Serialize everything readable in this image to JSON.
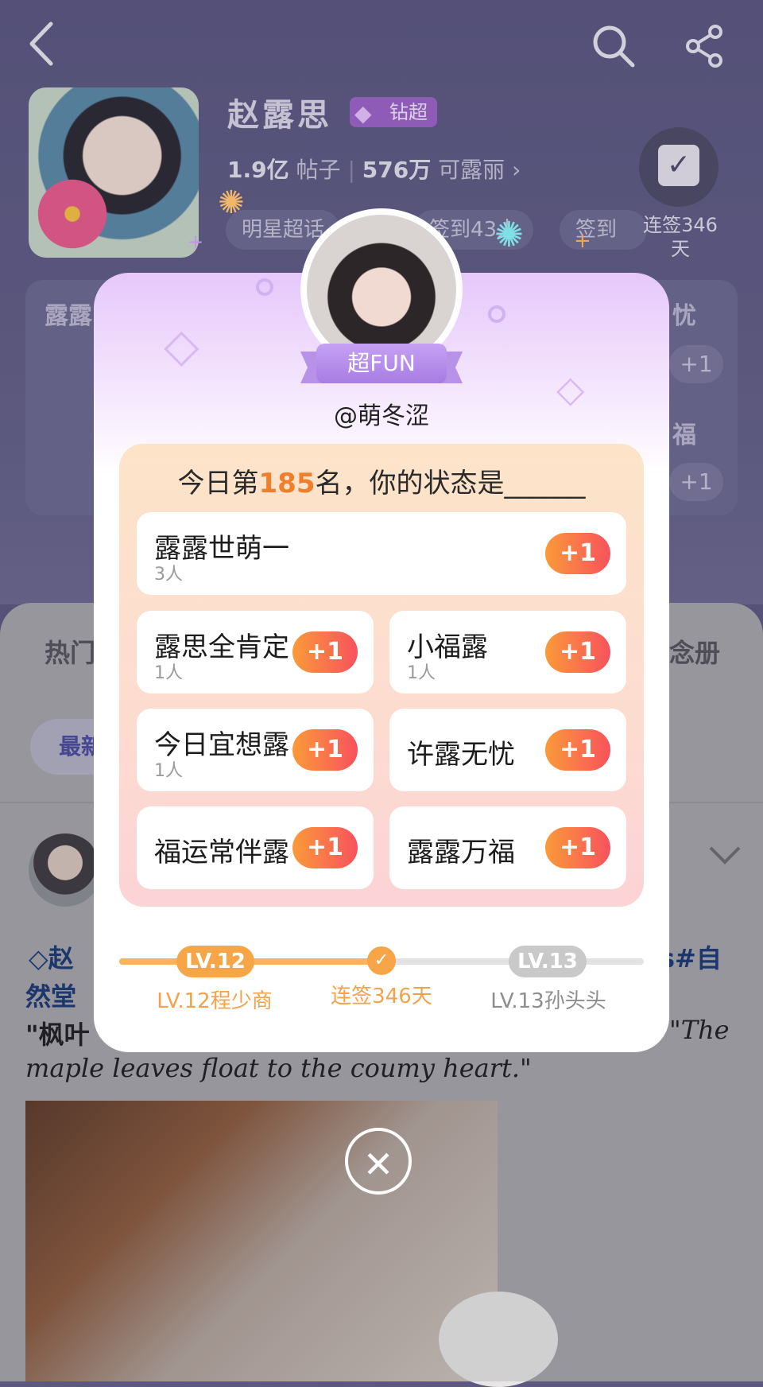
{
  "header": {
    "back_icon": "back-arrow-icon",
    "search_icon": "search-icon",
    "share_icon": "share-icon",
    "title": "赵露思",
    "badge": "钻超",
    "posts_value": "1.9亿",
    "posts_label": "帖子",
    "fans_value": "576万",
    "fans_label": "可露丽",
    "fans_arrow": "›",
    "chip_topic": "明星超话",
    "chip_checkin": "签到43人",
    "chip_third": "签到",
    "sign_icon": "calendar-check-icon",
    "sign_text": "连签346天"
  },
  "background_card": {
    "left_label": "露露",
    "right_label_1": "忧",
    "right_label_2": "福",
    "pill": "+1"
  },
  "background_lower": {
    "tab_hot": "热门",
    "tab_album": "念册",
    "filter_pill": "最新",
    "post_tag_left": "赵",
    "post_tag_right": "s#自",
    "post_line2": "然堂",
    "post_text_left": "\"枫叶",
    "post_text_right": "\"The",
    "post_script": "maple leaves float to the coumy heart.\""
  },
  "modal": {
    "ribbon": "超FUN",
    "username": "@萌冬涩",
    "question_prefix": "今日第",
    "rank": "185",
    "question_suffix": "名，你的状态是______",
    "plus_label": "+1",
    "options": [
      {
        "label": "露露世萌一",
        "count": "3人"
      },
      {
        "label": "露思全肯定",
        "count": "1人"
      },
      {
        "label": "小福露",
        "count": "1人"
      },
      {
        "label": "今日宜想露",
        "count": "1人"
      },
      {
        "label": "许露无忧",
        "count": ""
      },
      {
        "label": "福运常伴露",
        "count": ""
      },
      {
        "label": "露露万福",
        "count": ""
      }
    ],
    "level": {
      "current_badge": "LV.12",
      "next_badge": "LV.13",
      "current_caption": "LV.12程少商",
      "middle_caption": "连签346天",
      "next_caption": "LV.13孙头头",
      "progress": 0.5
    },
    "close_icon": "close-icon"
  },
  "colors": {
    "accent_orange": "#f07e2a",
    "plus_gradient_start": "#fb9a39",
    "plus_gradient_end": "#f8525d",
    "ribbon_purple": "#b892e8",
    "level_gray": "#b0b0b0"
  }
}
